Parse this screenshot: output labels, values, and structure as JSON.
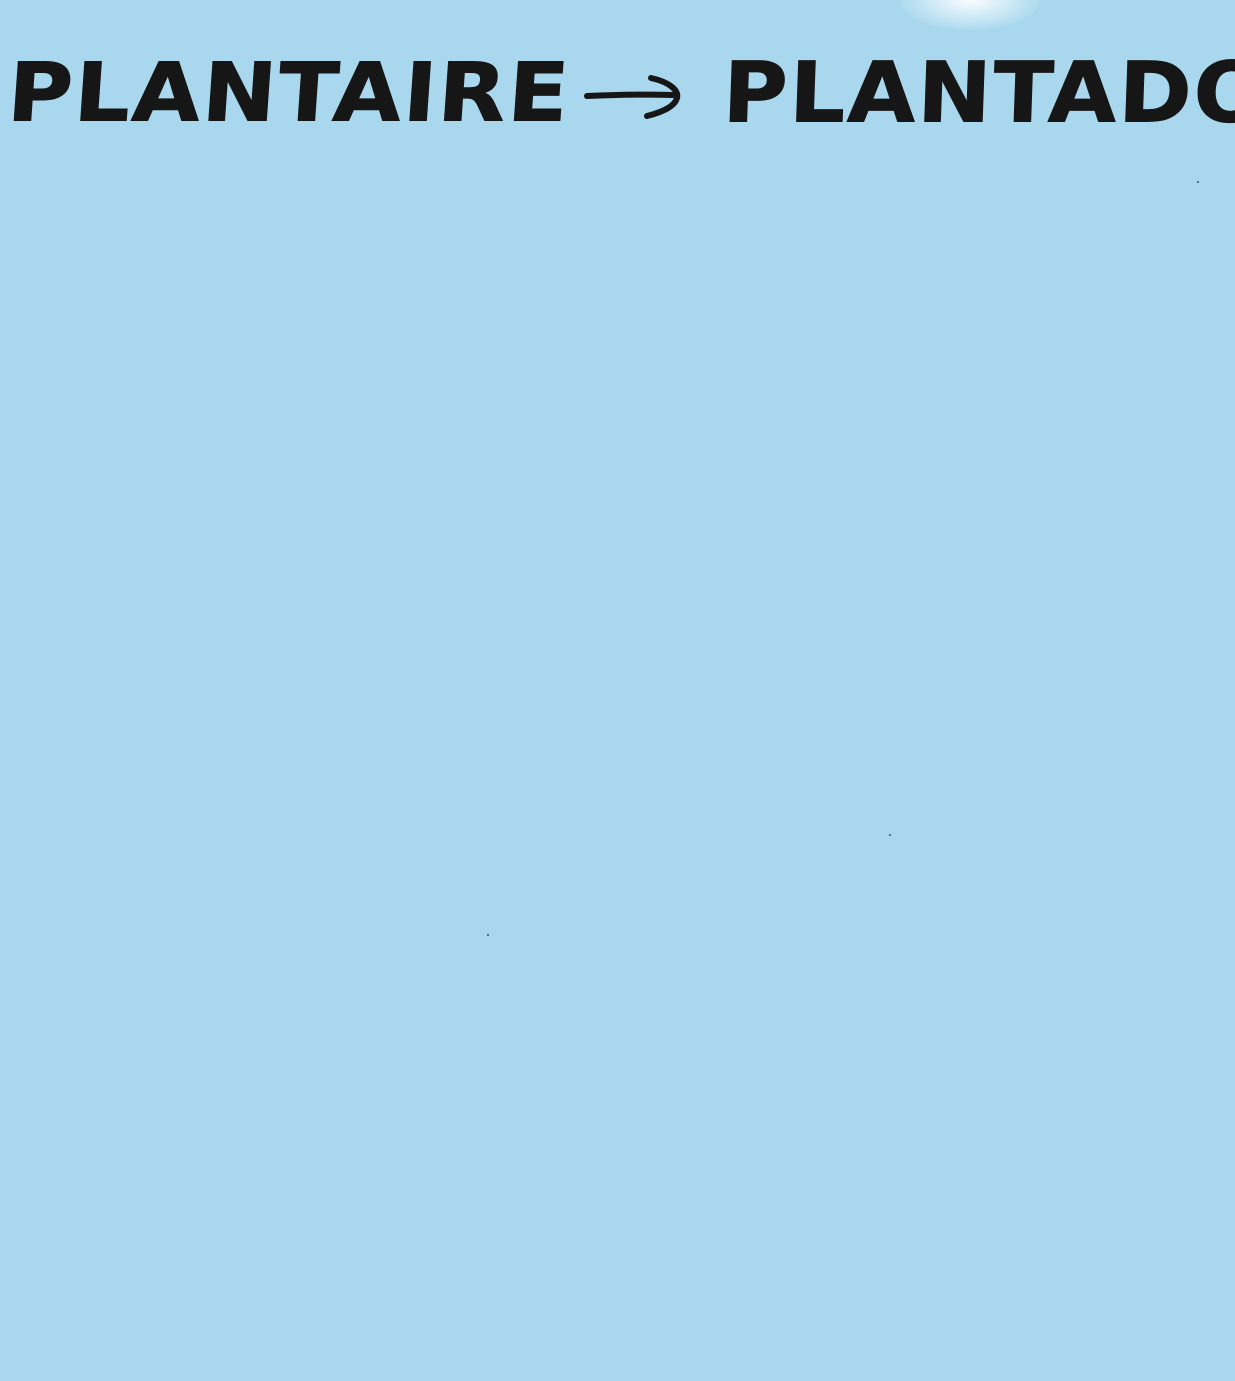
{
  "note": {
    "left_word": "PLANTAIRE",
    "arrow_icon": "right-arrow-icon",
    "right_word": "PLANTADOR"
  },
  "colors": {
    "paper": "#a9d8ee",
    "ink": "#161616"
  }
}
